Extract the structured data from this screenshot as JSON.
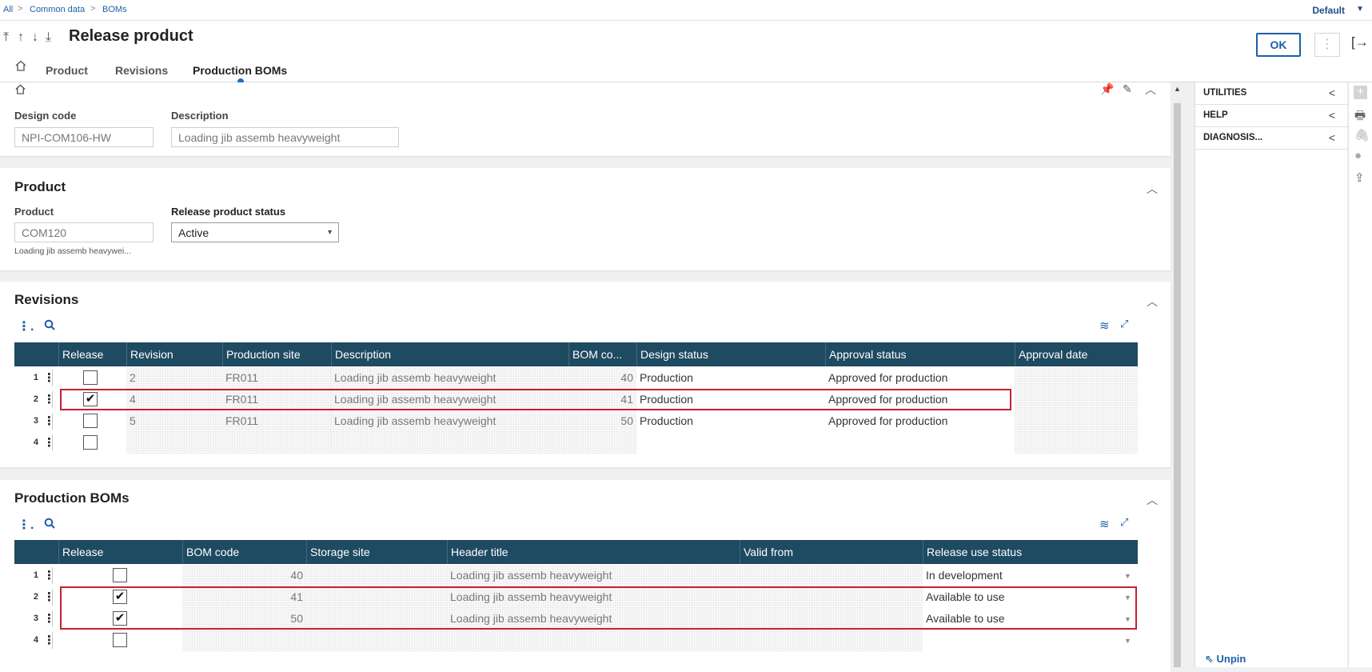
{
  "breadcrumb": {
    "items": [
      "All",
      "Common data",
      "BOMs"
    ]
  },
  "view_selector": {
    "label": "Default"
  },
  "header": {
    "nav_arrows": [
      "⤒",
      "↑",
      "↓",
      "⤓"
    ],
    "title": "Release product",
    "ok_label": "OK",
    "more_label": "⋮",
    "exit_label": "[→"
  },
  "tabs": [
    {
      "label": "Product",
      "active": false
    },
    {
      "label": "Revisions",
      "active": false
    },
    {
      "label": "Production BOMs",
      "active": true
    }
  ],
  "design_panel": {
    "design_code_label": "Design code",
    "design_code_value": "NPI-COM106-HW",
    "description_label": "Description",
    "description_value": "Loading jib assemb heavyweight"
  },
  "product_section": {
    "title": "Product",
    "product_label": "Product",
    "product_value": "COM120",
    "product_desc": "Loading jib assemb heavywei...",
    "status_label": "Release product status",
    "status_value": "Active"
  },
  "revisions_section": {
    "title": "Revisions",
    "columns": [
      "Release",
      "Revision",
      "Production site",
      "Description",
      "BOM co...",
      "Design status",
      "Approval status",
      "Approval date"
    ],
    "rows": [
      {
        "num": "1",
        "release": false,
        "revision": "2",
        "site": "FR011",
        "description": "Loading jib assemb heavyweight",
        "bom": "40",
        "design_status": "Production",
        "approval_status": "Approved for production",
        "approval_date": ""
      },
      {
        "num": "2",
        "release": true,
        "revision": "4",
        "site": "FR011",
        "description": "Loading jib assemb heavyweight",
        "bom": "41",
        "design_status": "Production",
        "approval_status": "Approved for production",
        "approval_date": ""
      },
      {
        "num": "3",
        "release": false,
        "revision": "5",
        "site": "FR011",
        "description": "Loading jib assemb heavyweight",
        "bom": "50",
        "design_status": "Production",
        "approval_status": "Approved for production",
        "approval_date": ""
      },
      {
        "num": "4",
        "release": false,
        "revision": "",
        "site": "",
        "description": "",
        "bom": "",
        "design_status": "",
        "approval_status": "",
        "approval_date": ""
      }
    ]
  },
  "boms_section": {
    "title": "Production BOMs",
    "columns": [
      "Release",
      "BOM code",
      "Storage site",
      "Header title",
      "Valid from",
      "Release use status"
    ],
    "rows": [
      {
        "num": "1",
        "release": false,
        "bom_code": "40",
        "storage_site": "",
        "header_title": "Loading jib assemb heavyweight",
        "valid_from": "",
        "use_status": "In development"
      },
      {
        "num": "2",
        "release": true,
        "bom_code": "41",
        "storage_site": "",
        "header_title": "Loading jib assemb heavyweight",
        "valid_from": "",
        "use_status": "Available to use"
      },
      {
        "num": "3",
        "release": true,
        "bom_code": "50",
        "storage_site": "",
        "header_title": "Loading jib assemb heavyweight",
        "valid_from": "",
        "use_status": "Available to use"
      },
      {
        "num": "4",
        "release": false,
        "bom_code": "",
        "storage_site": "",
        "header_title": "",
        "valid_from": "",
        "use_status": ""
      }
    ]
  },
  "right_panel": {
    "items": [
      "UTILITIES",
      "HELP",
      "DIAGNOSIS..."
    ],
    "unpin_label": "Unpin"
  },
  "colors": {
    "grid_header": "#1e4a62",
    "accent": "#1d5fa8",
    "highlight_outline": "#c8202f"
  }
}
